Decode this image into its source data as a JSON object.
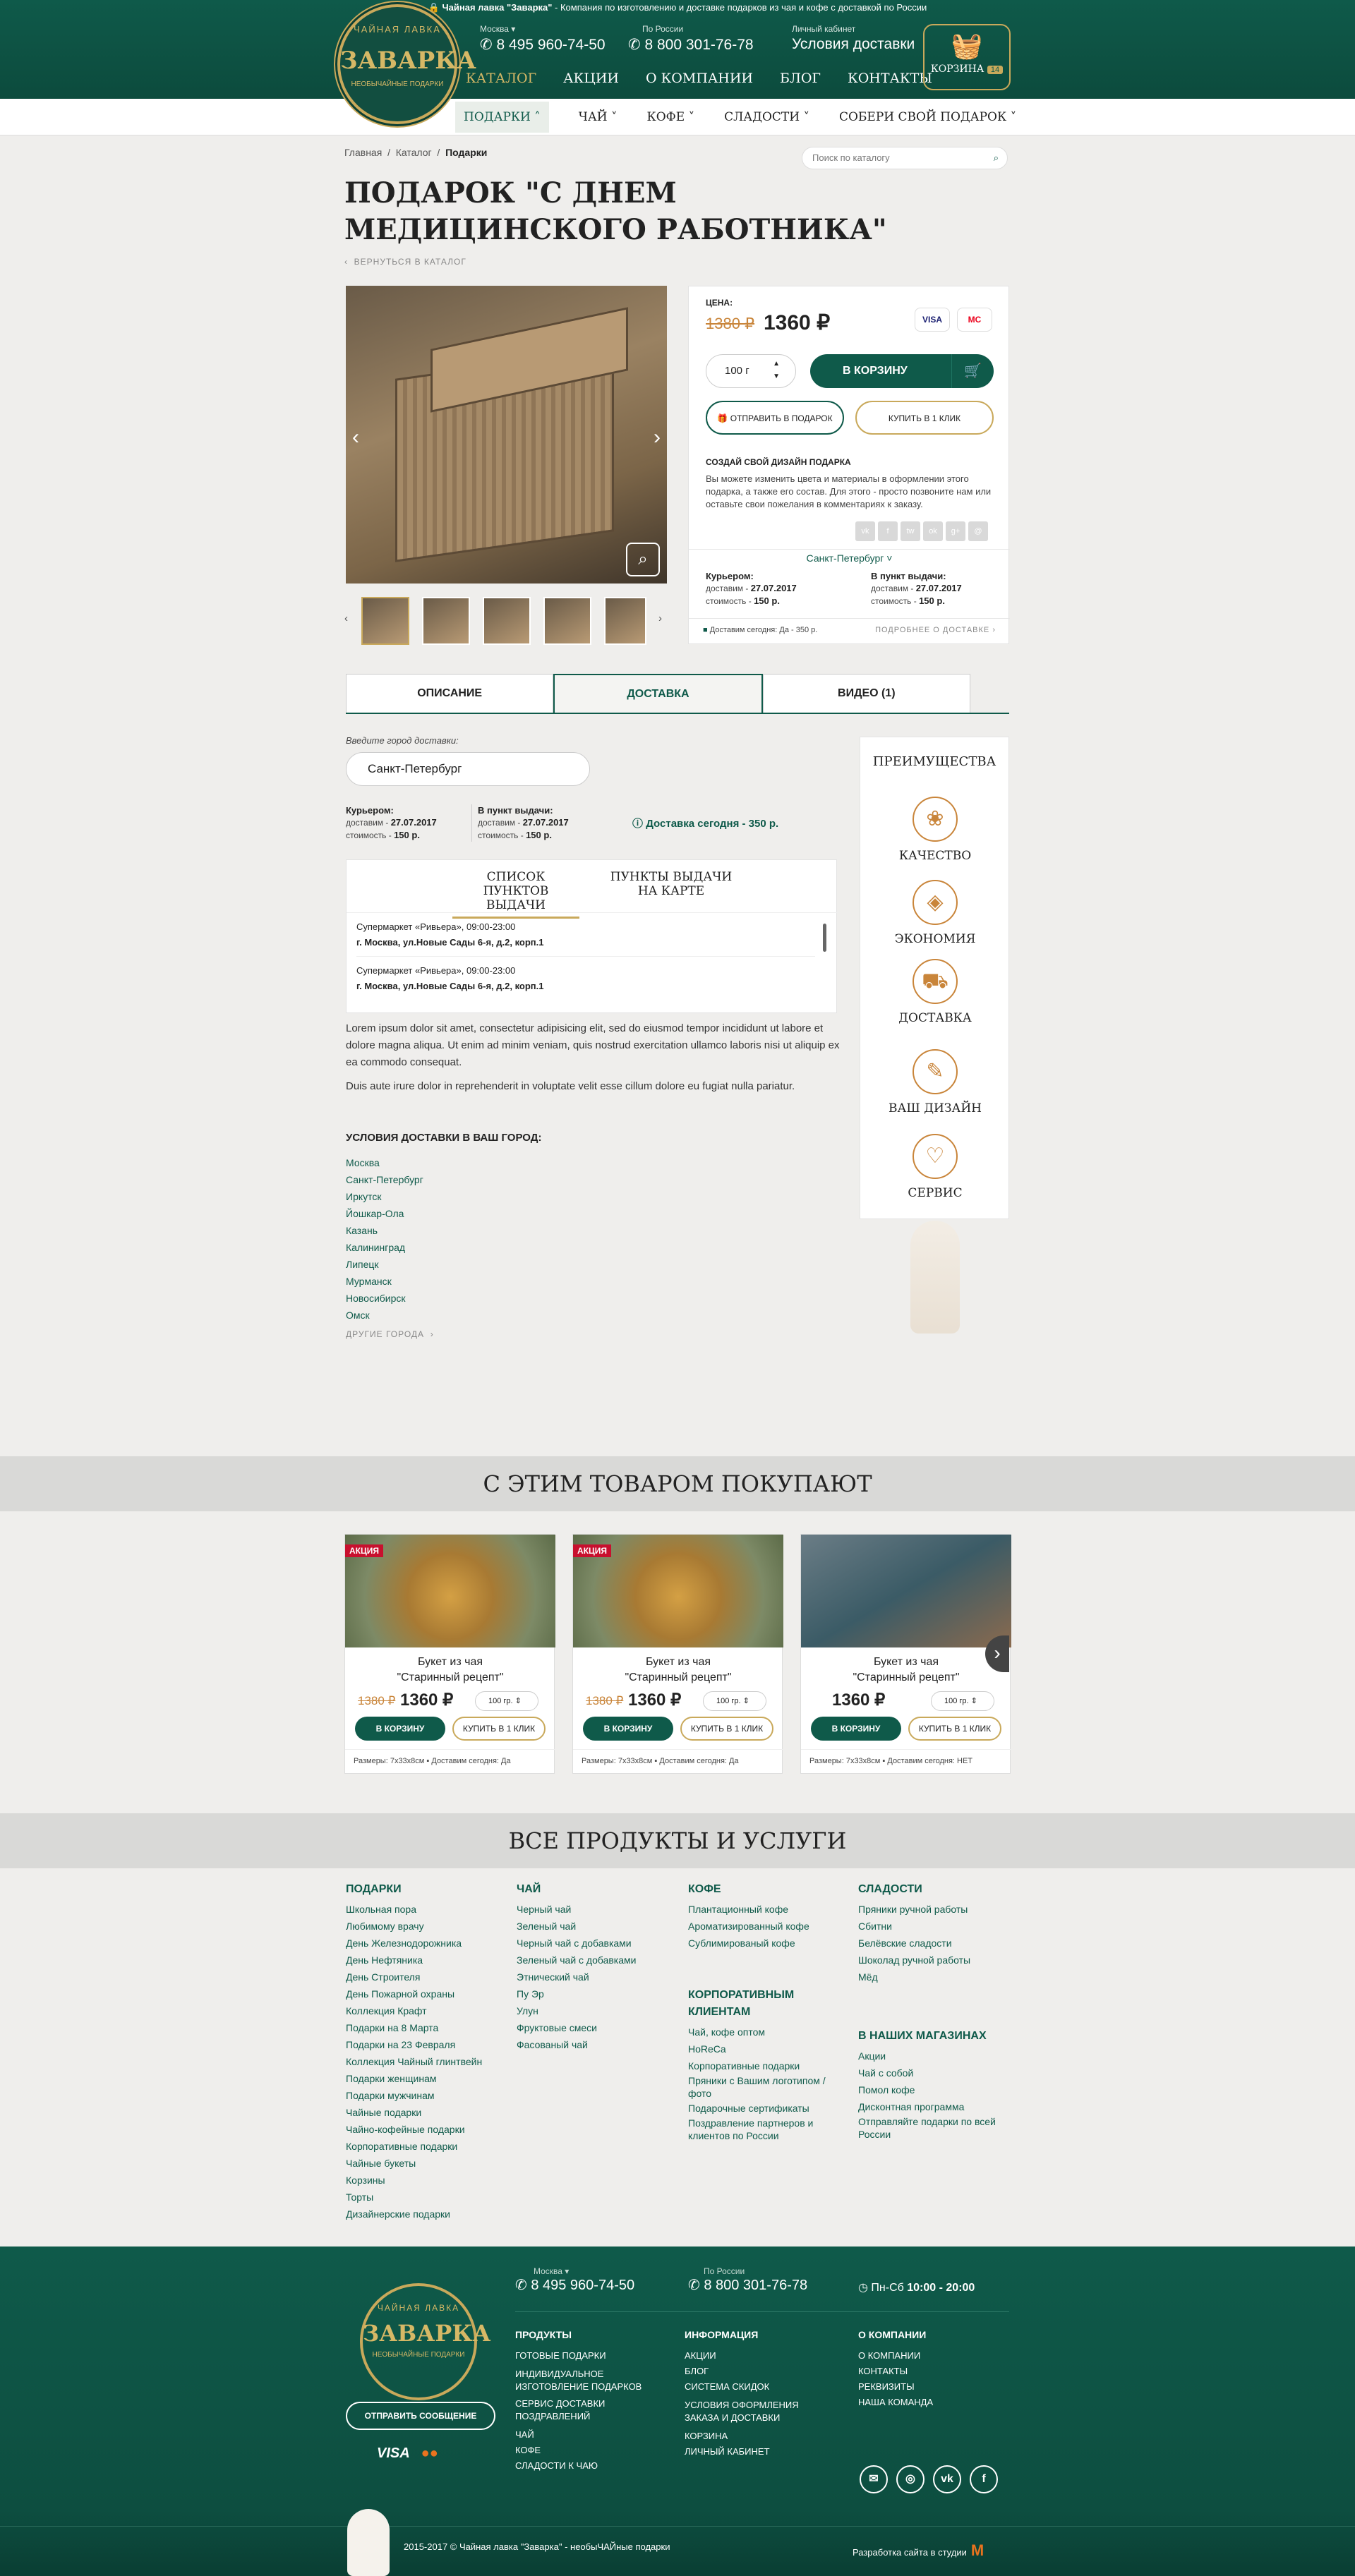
{
  "announce": {
    "brand": "Чайная лавка \"Заварка\"",
    "text": " - Компания по изготовлению и доставке подарков из чая и кофе с доставкой по России"
  },
  "logo": {
    "top": "ЧАЙНАЯ ЛАВКА",
    "name": "ЗАВАРКА",
    "bottom": "НЕОБЫЧАЙНЫЕ ПОДАРКИ"
  },
  "header": {
    "moscow_label": "Москва ▾",
    "moscow_phone": "8 495 960-74-50",
    "russia_label": "По России",
    "russia_phone": "8 800 301-76-78",
    "cabinet_label": "Личный кабинет",
    "delivery_link": "Условия доставки",
    "cart_label": "КОРЗИНА",
    "cart_count": "14"
  },
  "mainnav": [
    "КАТАЛОГ",
    "АКЦИИ",
    "О КОМПАНИИ",
    "БЛОГ",
    "КОНТАКТЫ"
  ],
  "subnav": [
    "ПОДАРКИ",
    "ЧАЙ",
    "КОФЕ",
    "СЛАДОСТИ",
    "СОБЕРИ СВОЙ ПОДАРОК"
  ],
  "crumbs": {
    "home": "Главная",
    "catalog": "Каталог",
    "current": "Подарки"
  },
  "search": {
    "placeholder": "Поиск по каталогу"
  },
  "product": {
    "title": "ПОДАРОК \"С ДНЕМ МЕДИЦИНСКОГО РАБОТНИКА\"",
    "back": "ВЕРНУТЬСЯ В КАТАЛОГ",
    "price_label": "ЦЕНА:",
    "old_price": "1380 ₽",
    "price": "1360 ₽",
    "card1": "VISA",
    "card2": "MC",
    "qty": "100 г",
    "cart_button": "В КОРЗИНУ",
    "gift_button": "ОТПРАВИТЬ В ПОДАРОК",
    "oneclick_button": "КУПИТЬ В 1 КЛИК",
    "design_title": "СОЗДАЙ СВОЙ ДИЗАЙН ПОДАРКА",
    "design_text": "Вы можете изменить цвета и материалы в оформлении этого подарка, а также его состав. Для этого - просто позвоните нам или оставьте свои пожелания в комментариях к заказу.",
    "social": [
      "vk",
      "f",
      "tw",
      "ok",
      "g+",
      "@"
    ],
    "city": "Санкт-Петербург",
    "courier": {
      "title": "Курьером:",
      "line1": "доставим - ",
      "date": "27.07.2017",
      "line2": "стоимость - ",
      "cost": "150 р."
    },
    "pickup": {
      "title": "В пункт выдачи:",
      "line1": "доставим - ",
      "date": "27.07.2017",
      "line2": "стоимость - ",
      "cost": "150 р."
    },
    "today": "Доставим сегодня: Да - 350 р.",
    "more": "ПОДРОБНЕЕ О ДОСТАВКЕ"
  },
  "tabs": [
    "ОПИСАНИЕ",
    "ДОСТАВКА",
    "ВИДЕО (1)"
  ],
  "delivery": {
    "label": "Введите город доставки:",
    "city": "Санкт-Петербург",
    "today": "Доставка сегодня - 350 р.",
    "list_tab": "СПИСОК ПУНКТОВ ВЫДАЧИ",
    "map_tab": "ПУНКТЫ ВЫДАЧИ НА КАРТЕ",
    "points": [
      {
        "name": "Супермаркет «Ривьера», 09:00-23:00",
        "addr": "г. Москва, ул.Новые Сады 6-я, д.2, корп.1"
      },
      {
        "name": "Супермаркет «Ривьера», 09:00-23:00",
        "addr": "г. Москва, ул.Новые Сады 6-я, д.2, корп.1"
      }
    ],
    "lorem1": "Lorem ipsum dolor sit amet, consectetur adipisicing elit, sed do eiusmod tempor incididunt ut labore et dolore magna aliqua. Ut enim ad minim veniam, quis nostrud exercitation ullamco laboris nisi ut aliquip ex ea commodo consequat.",
    "lorem2": "Duis aute irure dolor in reprehenderit in voluptate velit esse cillum dolore eu fugiat nulla pariatur.",
    "cond_title": "УСЛОВИЯ ДОСТАВКИ В ВАШ ГОРОД:",
    "cities": [
      "Москва",
      "Санкт-Петербург",
      "Иркутск",
      "Йошкар-Ола",
      "Казань",
      "Калининград",
      "Липецк",
      "Мурманск",
      "Новосибирск",
      "Омск"
    ],
    "other": "ДРУГИЕ ГОРОДА"
  },
  "advantages": {
    "title": "ПРЕИМУЩЕСТВА",
    "items": [
      "КАЧЕСТВО",
      "ЭКОНОМИЯ",
      "ДОСТАВКА",
      "ВАШ ДИЗАЙН",
      "СЕРВИС"
    ]
  },
  "related": {
    "title": "С ЭТИМ ТОВАРОМ ПОКУПАЮТ",
    "items": [
      {
        "badge": "АКЦИЯ",
        "name1": "Букет из чая",
        "name2": "\"Старинный рецепт\"",
        "old": "1380 ₽",
        "price": "1360 ₽",
        "qty": "100 гр.",
        "btn1": "В КОРЗИНУ",
        "btn2": "КУПИТЬ В 1 КЛИК",
        "foot": "Размеры: 7x33x8см  ▪ Доставим сегодня: Да"
      },
      {
        "badge": "АКЦИЯ",
        "name1": "Букет из чая",
        "name2": "\"Старинный рецепт\"",
        "old": "1380 ₽",
        "price": "1360 ₽",
        "qty": "100 гр.",
        "btn1": "В КОРЗИНУ",
        "btn2": "КУПИТЬ В 1 КЛИК",
        "foot": "Размеры: 7x33x8см  ▪ Доставим сегодня: Да"
      },
      {
        "badge": "",
        "name1": "Букет из чая",
        "name2": "\"Старинный рецепт\"",
        "old": "",
        "price": "1360 ₽",
        "qty": "100 гр.",
        "btn1": "В КОРЗИНУ",
        "btn2": "КУПИТЬ В 1 КЛИК",
        "foot": "Размеры: 7x33x8см  ▪ Доставим сегодня: НЕТ"
      }
    ]
  },
  "allproducts": {
    "title": "ВСЕ ПРОДУКТЫ И УСЛУГИ",
    "gifts": {
      "h": "ПОДАРКИ",
      "items": [
        "Школьная пора",
        "Любимому врачу",
        "День Железнодорожника",
        "День Нефтяника",
        "День Строителя",
        "День Пожарной охраны",
        "Коллекция Крафт",
        "Подарки на 8 Марта",
        "Подарки на 23 Февраля",
        "Коллекция Чайный глинтвейн",
        "Подарки женщинам",
        "Подарки мужчинам",
        "Чайные подарки",
        "Чайно-кофейные подарки",
        "Корпоративные подарки",
        "Чайные букеты",
        "Корзины",
        "Торты",
        "Дизайнерские подарки"
      ]
    },
    "tea": {
      "h": "ЧАЙ",
      "items": [
        "Черный чай",
        "Зеленый чай",
        "Черный чай с добавками",
        "Зеленый чай с добавками",
        "Этнический чай",
        "Пу Эр",
        "Улун",
        "Фруктовые смеси",
        "Фасованый чай"
      ]
    },
    "coffee": {
      "h": "КОФЕ",
      "items": [
        "Плантационный кофе",
        "Ароматизированный кофе",
        "Сублимированый кофе"
      ]
    },
    "corp": {
      "h": "КОРПОРАТИВНЫМ КЛИЕНТАМ",
      "items": [
        "Чай, кофе оптом",
        "HoReCa",
        "Корпоративные подарки",
        "Пряники с Вашим логотипом /фото",
        "Подарочные сертификаты",
        "Поздравление партнеров и клиентов по России"
      ]
    },
    "sweets": {
      "h": "СЛАДОСТИ",
      "items": [
        "Пряники ручной работы",
        "Сбитни",
        "Белёвские сладости",
        "Шоколад ручной работы",
        "Мёд"
      ]
    },
    "shops": {
      "h": "В НАШИХ МАГАЗИНАХ",
      "items": [
        "Акции",
        "Чай с собой",
        "Помол кофе",
        "Дисконтная программа",
        "Отправляйте подарки по всей России"
      ]
    }
  },
  "footer": {
    "moscow_label": "Москва ▾",
    "moscow_phone": "8 495 960-74-50",
    "russia_label": "По России",
    "russia_phone": "8 800 301-76-78",
    "hours_label": "Пн-Сб ",
    "hours": "10:00 - 20:00",
    "msg_button": "ОТПРАВИТЬ СООБЩЕНИЕ",
    "pay1": "VISA",
    "pay2": "●●",
    "products": {
      "h": "ПРОДУКТЫ",
      "items": [
        "ГОТОВЫЕ ПОДАРКИ",
        "ИНДИВИДУАЛЬНОЕ ИЗГОТОВЛЕНИЕ ПОДАРКОВ",
        "СЕРВИС ДОСТАВКИ ПОЗДРАВЛЕНИЙ",
        "ЧАЙ",
        "КОФЕ",
        "СЛАДОСТИ К ЧАЮ"
      ]
    },
    "info": {
      "h": "ИНФОРМАЦИЯ",
      "items": [
        "АКЦИИ",
        "БЛОГ",
        "СИСТЕМА СКИДОК",
        "УСЛОВИЯ ОФОРМЛЕНИЯ ЗАКАЗА И ДОСТАВКИ",
        "КОРЗИНА",
        "ЛИЧНЫЙ КАБИНЕТ"
      ]
    },
    "company": {
      "h": "О КОМПАНИИ",
      "items": [
        "О КОМПАНИИ",
        "КОНТАКТЫ",
        "РЕКВИЗИТЫ",
        "НАША КОМАНДА"
      ]
    },
    "social": [
      "✉",
      "◎",
      "vk",
      "f"
    ],
    "copy": "2015-2017 © Чайная лавка \"Заварка\" - необыЧАЙные подарки",
    "dev": "Разработка сайта в студии",
    "dev_logo": "M"
  }
}
